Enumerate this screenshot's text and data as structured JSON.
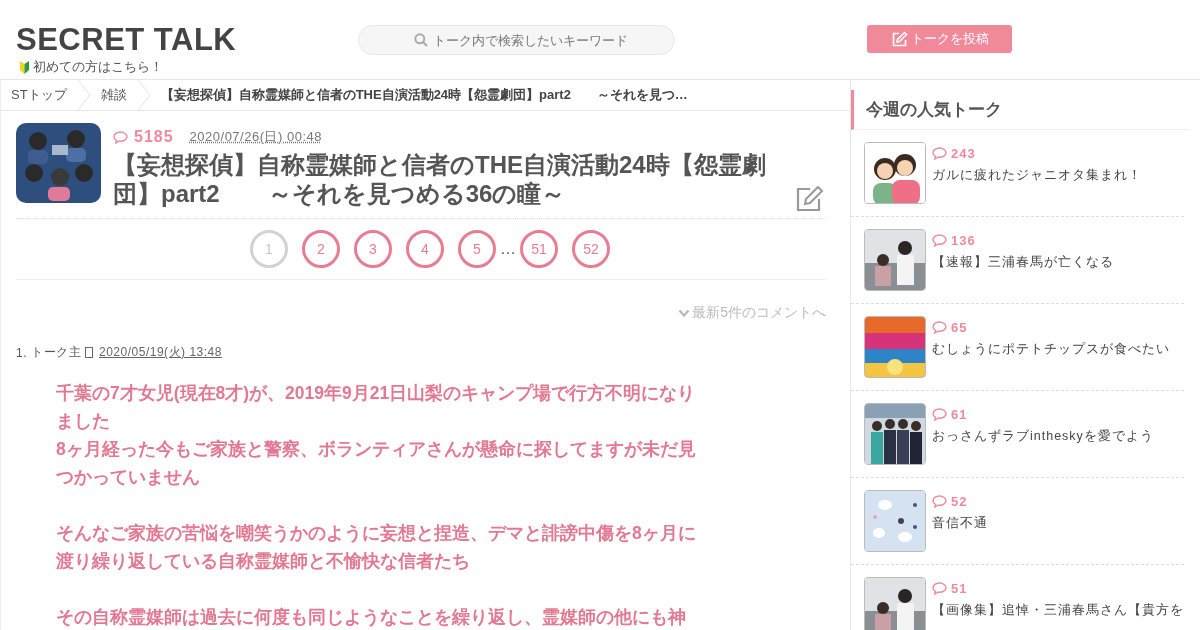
{
  "header": {
    "logo": "SECRET TALK",
    "beginner_link": "初めての方はこちら！",
    "search": {
      "placeholder": "トーク内で検索したいキーワード"
    },
    "post_button": "トークを投稿"
  },
  "breadcrumb": [
    "STトップ",
    "雑談",
    "【妄想探偵】自称霊媒師と信者のTHE自演活動24時【怨霊劇団】part2　　～それを見つ…"
  ],
  "thread": {
    "comment_count": "5185",
    "date": "2020/07/26(日) 00:48",
    "title": "【妄想探偵】自称霊媒師と信者のTHE自演活動24時【怨霊劇団】part2　　～それを見つめる36の瞳～",
    "pages": [
      {
        "label": "1",
        "selected": true
      },
      {
        "label": "2",
        "selected": false
      },
      {
        "label": "3",
        "selected": false
      },
      {
        "label": "4",
        "selected": false
      },
      {
        "label": "5",
        "selected": false
      },
      {
        "label": "…",
        "kind": "gap"
      },
      {
        "label": "51",
        "selected": false
      },
      {
        "label": "52",
        "selected": false
      }
    ],
    "latest_link": "最新5件のコメントへ",
    "comment": {
      "number": "1.",
      "author": "トーク主",
      "date": "2020/05/19(火) 13:48",
      "paragraphs": [
        [
          "千葉の7才女児(現在8才)が、2019年9月21日山梨のキャンプ場で行方不明になりました",
          "8ヶ月経った今もご家族と警察、ボランティアさんが懸命に探してますが未だ見つかっていません"
        ],
        [
          "そんなご家族の苦悩を嘲笑うかのように妄想と捏造、デマと誹謗中傷を8ヶ月に渡り繰り返している自称霊媒師と不愉快な信者たち"
        ],
        [
          "その自称霊媒師は過去に何度も同じようなことを繰り返し、霊媒師の他にも神"
        ]
      ]
    }
  },
  "sidebar": {
    "title": "今週の人気トーク",
    "items": [
      {
        "count": "243",
        "title": "ガルに疲れたジャニオタ集まれ！",
        "kind": "figures"
      },
      {
        "count": "136",
        "title": "【速報】三浦春馬が亡くなる"
      },
      {
        "count": "65",
        "title": "むしょうにポテトチップスが食べたい",
        "kind": "snack"
      },
      {
        "count": "61",
        "title": "おっさんずラブintheskyを愛でよう",
        "kind": "group"
      },
      {
        "count": "52",
        "title": "音信不通",
        "kind": "pattern"
      },
      {
        "count": "51",
        "title": "【画像集】追悼・三浦春馬さん【貴方を"
      }
    ]
  }
}
